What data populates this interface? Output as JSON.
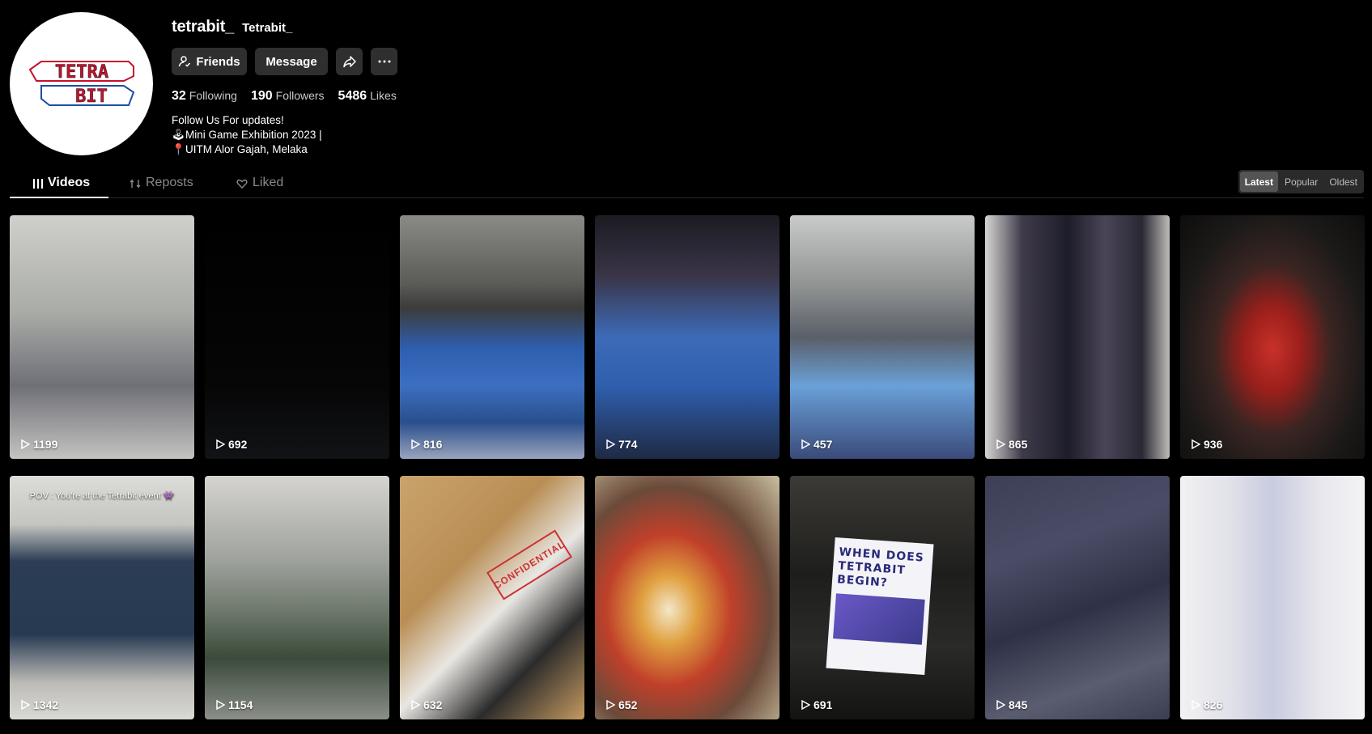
{
  "profile": {
    "username": "tetrabit_",
    "nickname": "Tetrabit_",
    "avatar_logo_text": [
      "TETRA",
      "BIT"
    ],
    "buttons": {
      "friends": "Friends",
      "message": "Message"
    },
    "stats": {
      "following_count": "32",
      "following_label": "Following",
      "followers_count": "190",
      "followers_label": "Followers",
      "likes_count": "5486",
      "likes_label": "Likes"
    },
    "bio": {
      "line1": "Follow Us For updates!",
      "line2": "Mini Game Exhibition 2023 |",
      "line3": "UITM Alor Gajah, Melaka"
    }
  },
  "tabs": {
    "videos": "Videos",
    "reposts": "Reposts",
    "liked": "Liked"
  },
  "sort": {
    "latest": "Latest",
    "popular": "Popular",
    "oldest": "Oldest",
    "selected": "Latest"
  },
  "videos": [
    {
      "views": "1199"
    },
    {
      "views": "692"
    },
    {
      "views": "816"
    },
    {
      "views": "774"
    },
    {
      "views": "457"
    },
    {
      "views": "865"
    },
    {
      "views": "936"
    },
    {
      "views": "1342",
      "caption": "POV : You're at the Tetrabit event 👾"
    },
    {
      "views": "1154"
    },
    {
      "views": "632",
      "stamp_text": "CONFIDENTIAL"
    },
    {
      "views": "652"
    },
    {
      "views": "691",
      "poster_text": "WHEN DOES TETRABIT BEGIN?"
    },
    {
      "views": "845"
    },
    {
      "views": "826"
    }
  ],
  "colors": {
    "background": "#000000",
    "button_bg": "#2f2f2f",
    "muted_text": "#8a8a8a",
    "logo_red": "#c8102e",
    "logo_blue": "#1a4fa0"
  }
}
